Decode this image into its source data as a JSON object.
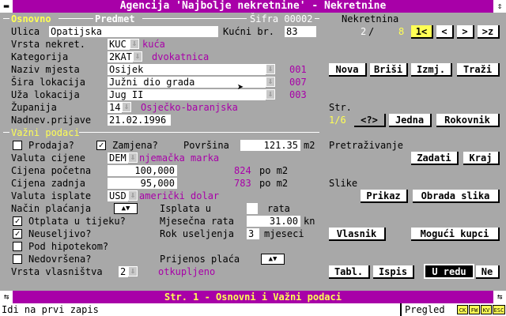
{
  "title": "Agencija 'Najbolje nekretnine' - Nekretnine",
  "tabs": {
    "osnovno": "Osnovno",
    "predmet": "Predmet",
    "sifra": "Šifra 00002"
  },
  "osnovno": {
    "ulica_lbl": "Ulica",
    "ulica": "Opatijska",
    "kucni_lbl": "Kućni br.",
    "kucni": "83",
    "vrsta_lbl": "Vrsta nekret.",
    "vrsta_code": "KUC",
    "vrsta_name": "kuća",
    "kat_lbl": "Kategorija",
    "kat_code": "2KAT",
    "kat_name": "dvokatnica",
    "mjesto_lbl": "Naziv mjesta",
    "mjesto": "Osijek",
    "mjesto_code": "001",
    "sira_lbl": "Šira lokacija",
    "sira": "Južni dio grada",
    "sira_code": "007",
    "uza_lbl": "Uža lokacija",
    "uza": "Jug II",
    "uza_code": "003",
    "zup_lbl": "Županija",
    "zup_code": "14",
    "zup_name": "Osječko-baranjska",
    "nadnev_lbl": "Nadnev.prijave",
    "nadnev": "21.02.1996"
  },
  "vazni": {
    "header": "Važni podaci",
    "prodaja": "Prodaja?",
    "zamjena": "Zamjena?",
    "zamjena_check": "✓",
    "povrsina_lbl": "Površina",
    "povrsina": "121.35",
    "povrsina_unit": "m2",
    "valuta_lbl": "Valuta cijene",
    "valuta_code": "DEM",
    "valuta_name": "njemačka marka",
    "cp_lbl": "Cijena početna",
    "cp": "100,000",
    "cp_m2": "824",
    "po_m2": "po m2",
    "cz_lbl": "Cijena zadnja",
    "cz": "95,000",
    "cz_m2": "783",
    "vi_lbl": "Valuta isplate",
    "vi_code": "USD",
    "vi_name": "američki dolar",
    "nacin_lbl": "Način plaćanja",
    "isplata_lbl": "Isplata u",
    "rata_lbl": "rata",
    "otplata": "Otplata u tijeku?",
    "otplata_check": "✓",
    "mjesecna_lbl": "Mjesečna rata",
    "mjesecna": "31.00",
    "mjesecna_unit": "kn",
    "neuseljivo": "Neuseljivo?",
    "neuseljivo_check": "✓",
    "rok_lbl": "Rok useljenja",
    "rok": "3",
    "rok_unit": "mjeseci",
    "hipoteka": "Pod hipotekom?",
    "nedovrsena": "Nedovršena?",
    "prijenos_lbl": "Prijenos plaća",
    "vlasnistvo_lbl": "Vrsta vlasništva",
    "vlasnistvo_code": "2",
    "vlasnistvo_name": "otkupljeno"
  },
  "right": {
    "nekretnina_lbl": "Nekretnina",
    "rec_cur": "2",
    "rec_sep": "/",
    "rec_tot": "8",
    "nav1": "1<",
    "nav2": "<",
    "nav3": ">",
    "nav4": ">z",
    "nova": "Nova",
    "brisi": "Briši",
    "izmj": "Izmj.",
    "trazi": "Traži",
    "str_lbl": "Str.",
    "str_val": "1/6",
    "help": "<?>",
    "jedna": "Jedna",
    "rokovnik": "Rokovnik",
    "pretr_lbl": "Pretraživanje",
    "zadati": "Zadati",
    "kraj": "Kraj",
    "slike_lbl": "Slike",
    "prikaz": "Prikaz",
    "obrada": "Obrada slika",
    "vlasnik": "Vlasnik",
    "kupci": "Mogući kupci",
    "tabl": "Tabl.",
    "ispis": "Ispis",
    "ured": "U redu",
    "ne": "Ne"
  },
  "status": {
    "page": "Str. 1 - Osnovni i Važni podaci",
    "hint": "Idi na prvi zapis",
    "mode": "Pregled",
    "keys": [
      "CK",
      "FW",
      "KV",
      "ESC"
    ]
  },
  "colors": {
    "accent": "#a800a8",
    "highlight": "#ffff54",
    "panel": "#a8a8a8"
  }
}
